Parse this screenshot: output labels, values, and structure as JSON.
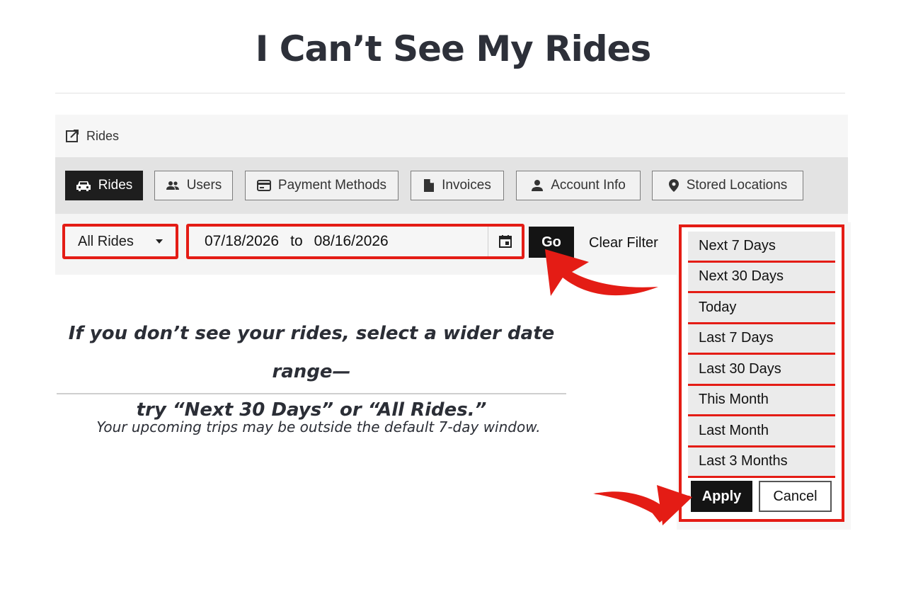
{
  "page": {
    "title": "I Can’t See My Rides"
  },
  "header": {
    "label": "Rides",
    "icon": "external-link-icon"
  },
  "nav": {
    "tabs": [
      {
        "label": "Rides",
        "icon": "car-icon",
        "active": true
      },
      {
        "label": "Users",
        "icon": "users-icon",
        "active": false
      },
      {
        "label": "Payment Methods",
        "icon": "credit-card-icon",
        "active": false
      },
      {
        "label": "Invoices",
        "icon": "document-icon",
        "active": false
      },
      {
        "label": "Account Info",
        "icon": "person-icon",
        "active": false
      },
      {
        "label": "Stored Locations",
        "icon": "location-pin-icon",
        "active": false
      }
    ]
  },
  "filter": {
    "rides_select": {
      "value": "All Rides"
    },
    "date_range": {
      "from": "07/18/2026",
      "separator": "to",
      "to": "08/16/2026"
    },
    "go_label": "Go",
    "clear_label": "Clear Filter"
  },
  "callout": {
    "main_line1": "If you don’t see your rides, select a wider date range—",
    "main_line2": "try “Next 30 Days” or “All Rides.”",
    "sub": "Your upcoming trips may be outside the default 7-day window."
  },
  "range_menu": {
    "options": [
      "Next 7 Days",
      "Next 30 Days",
      "Today",
      "Last 7 Days",
      "Last 30 Days",
      "This Month",
      "Last Month",
      "Last 3 Months"
    ],
    "apply_label": "Apply",
    "cancel_label": "Cancel"
  },
  "colors": {
    "highlight": "#e41c15",
    "active_tab": "#1e1e1e",
    "title_text": "#2d3039"
  }
}
